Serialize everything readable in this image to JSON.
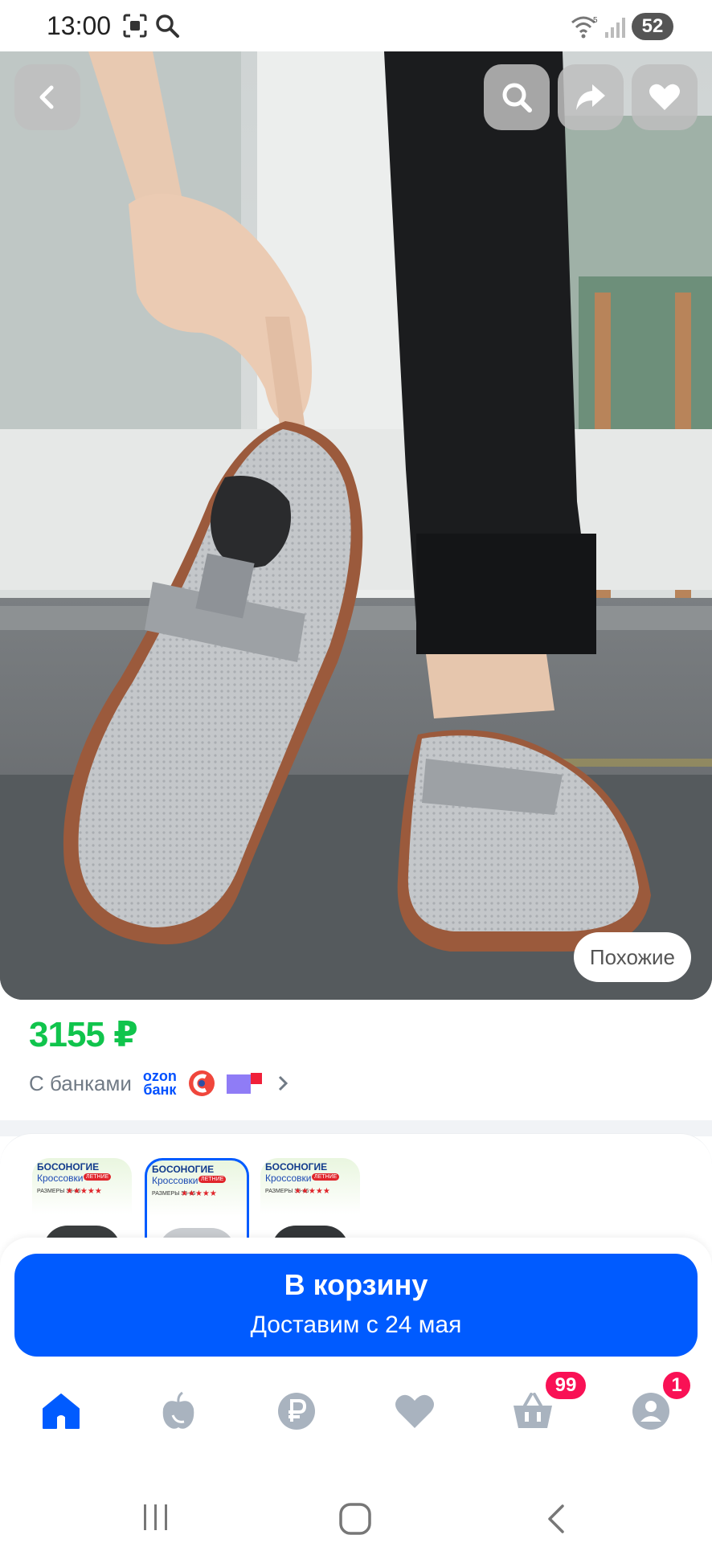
{
  "status_bar": {
    "time": "13:00",
    "battery": "52",
    "wifi_label": "5"
  },
  "product": {
    "price": "3155 ₽",
    "banks_label": "С банками",
    "ozon_bank_line1": "ozon",
    "ozon_bank_line2": "банк",
    "similar_label": "Похожие"
  },
  "variants": [
    {
      "title": "БОСОНОГИЕ",
      "subtitle": "Кроссовки",
      "badge": "ЛЕТНИЕ",
      "sizes": "РАЗМЕРЫ 36-46",
      "stars": "★★★★★",
      "shoe_color": "#3a3d3e",
      "selected": false
    },
    {
      "title": "БОСОНОГИЕ",
      "subtitle": "Кроссовки",
      "badge": "ЛЕТНИЕ",
      "sizes": "РАЗМЕРЫ 36-46",
      "stars": "★★★★★",
      "shoe_color": "#c9ccd0",
      "selected": true
    },
    {
      "title": "БОСОНОГИЕ",
      "subtitle": "Кроссовки",
      "badge": "ЛЕТНИЕ",
      "sizes": "РАЗМЕРЫ 36-46",
      "stars": "★★★★★",
      "shoe_color": "#333638",
      "selected": false
    }
  ],
  "cart_button": {
    "label": "В корзину",
    "delivery": "Доставим с 24 мая"
  },
  "bottom_nav": {
    "items": [
      {
        "name": "home",
        "icon": "home-icon"
      },
      {
        "name": "fresh",
        "icon": "apple-icon"
      },
      {
        "name": "finance",
        "icon": "ruble-icon"
      },
      {
        "name": "favorites",
        "icon": "heart-icon"
      },
      {
        "name": "cart",
        "icon": "basket-icon",
        "badge": "99"
      },
      {
        "name": "profile",
        "icon": "user-icon",
        "badge": "1"
      }
    ]
  },
  "colors": {
    "accent": "#005bff",
    "price": "#10c44c",
    "badge": "#f91155",
    "nav_inactive": "#a9b3bf"
  }
}
